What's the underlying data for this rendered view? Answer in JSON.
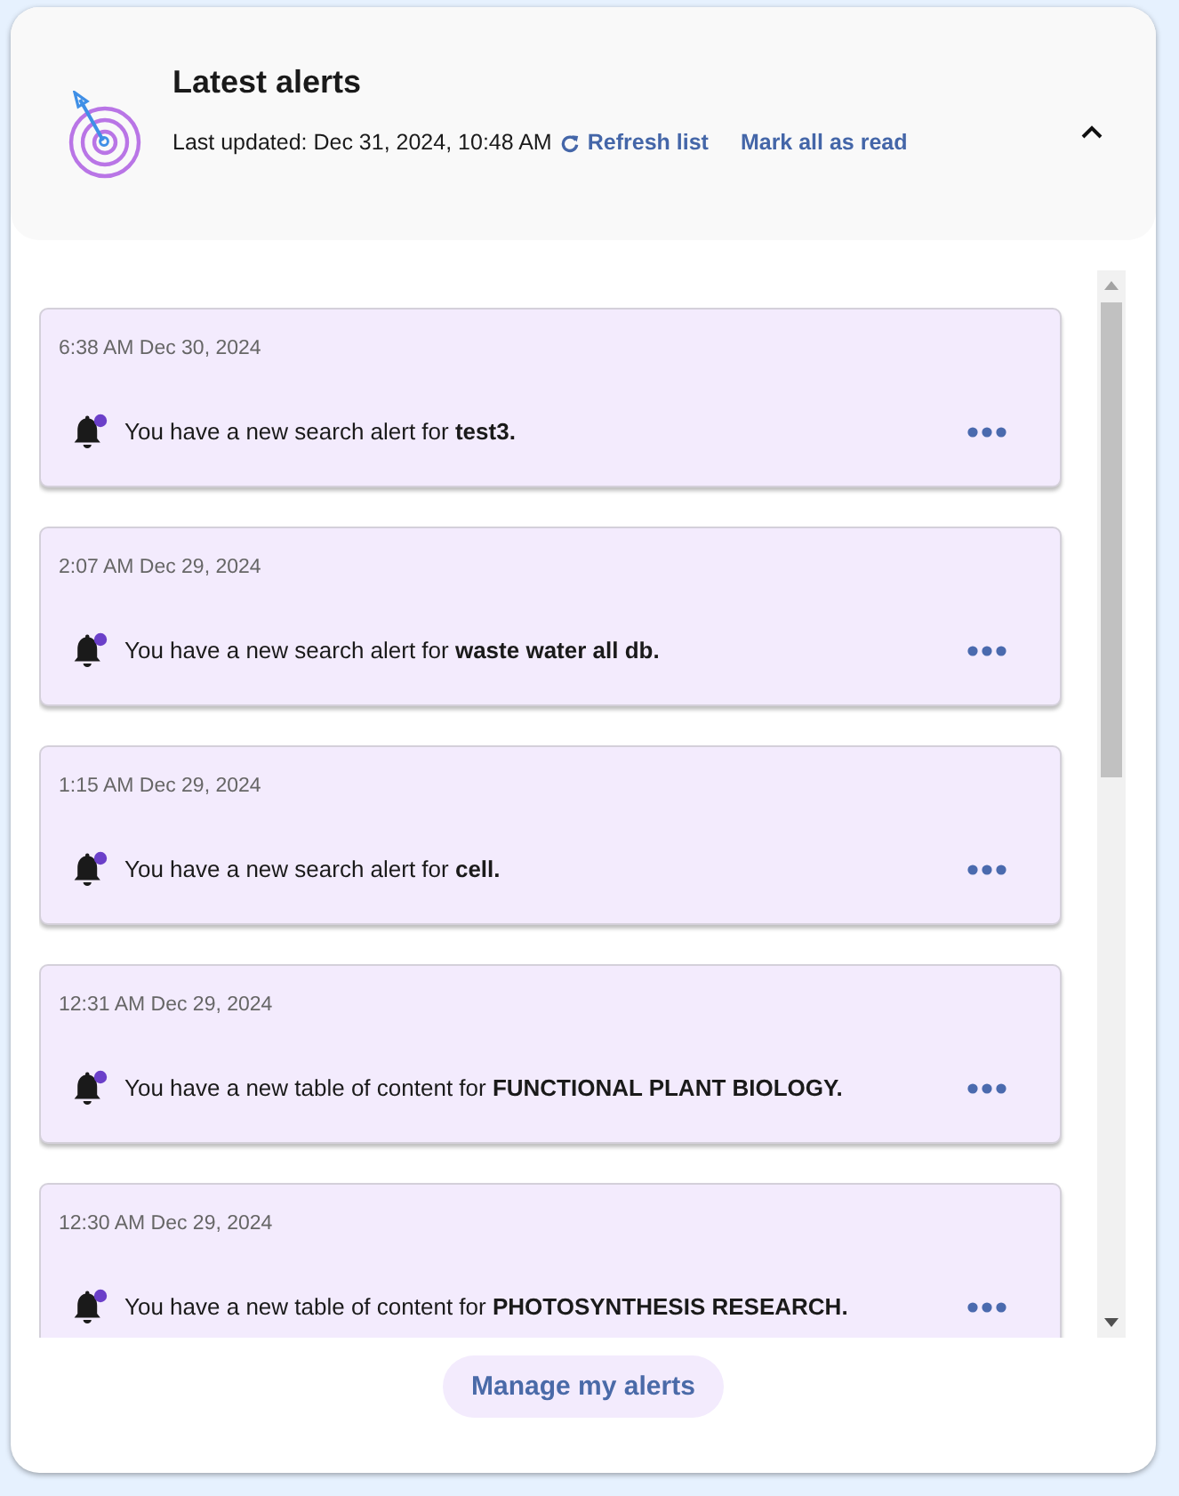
{
  "header": {
    "title": "Latest alerts",
    "last_updated": "Last updated: Dec 31, 2024, 10:48 AM",
    "refresh": "Refresh list",
    "mark_all_read": "Mark all as read",
    "expanded": true
  },
  "alerts": [
    {
      "time": "6:38 AM Dec 30, 2024",
      "message": "You have a new search alert for **test3.**",
      "unread": true
    },
    {
      "time": "2:07 AM Dec 29, 2024",
      "message": "You have a new search alert for **waste water all db.**",
      "unread": true
    },
    {
      "time": "1:15 AM Dec 29, 2024",
      "message": "You have a new search alert for **cell.**",
      "unread": true
    },
    {
      "time": "12:31 AM Dec 29, 2024",
      "message": "You have a new table of content for **FUNCTIONAL PLANT BIOLOGY.**",
      "unread": true
    },
    {
      "time": "12:30 AM Dec 29, 2024",
      "message": "You have a new table of content for **PHOTOSYNTHESIS RESEARCH.**",
      "unread": true
    }
  ],
  "footer": {
    "button": "Manage my alerts"
  }
}
